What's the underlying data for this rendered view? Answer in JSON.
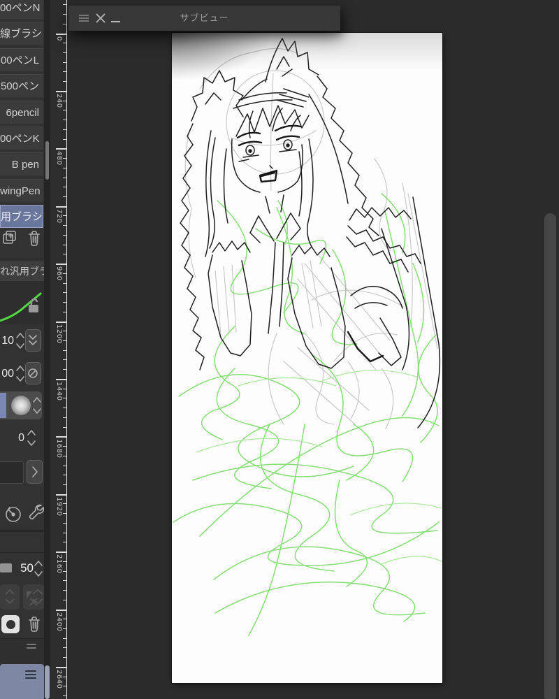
{
  "subview": {
    "title": "サブビュー"
  },
  "sidebar": {
    "brushes": [
      {
        "label": "00ペンN",
        "selected": false
      },
      {
        "label": "線ブラシ",
        "selected": false
      },
      {
        "label": "00ペンL",
        "selected": false
      },
      {
        "label": "500ペン",
        "selected": false
      },
      {
        "label": "6pencil",
        "selected": false
      },
      {
        "label": "00ペンK",
        "selected": false
      },
      {
        "label": "B pen",
        "selected": false
      },
      {
        "label": "wingPen",
        "selected": false
      },
      {
        "label": "用ブラシ",
        "selected": true
      }
    ],
    "category_label": "れ汎用ブラシ",
    "steppers": {
      "size": "10",
      "second": "00",
      "fourth": "0",
      "opacity": "50"
    }
  },
  "ruler": {
    "labels": [
      "0",
      "240",
      "480",
      "720",
      "960",
      "1200",
      "1440",
      "1680",
      "1920",
      "2160",
      "2400",
      "2640"
    ]
  },
  "colors": {
    "accent_selection": "#6b769c",
    "sketch_green": "#7edd6d",
    "sketch_gray": "#c9c9c9",
    "sketch_black": "#1f1f1f"
  }
}
